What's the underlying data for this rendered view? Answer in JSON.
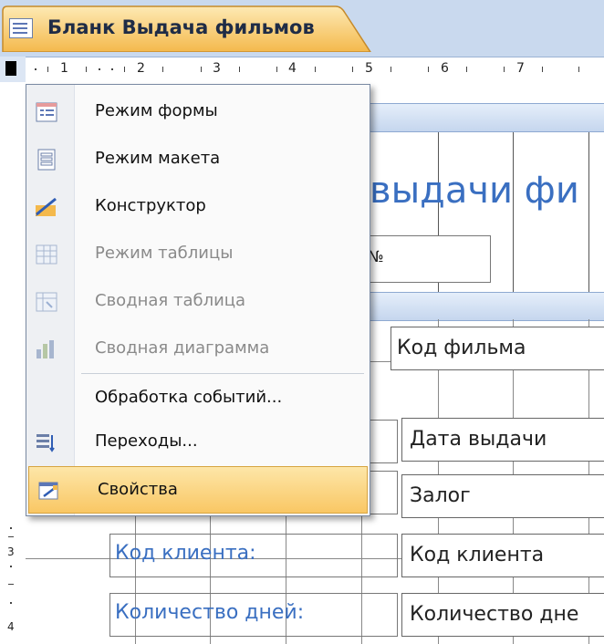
{
  "tab": {
    "title": "Бланк Выдача фильмов"
  },
  "ruler": {
    "h_numbers": [
      "1",
      "2",
      "3",
      "4",
      "5",
      "6",
      "7"
    ],
    "v_numbers": [
      "3",
      "4"
    ]
  },
  "form": {
    "title_fragment": "выдачи фи",
    "number_label": "№",
    "fields": [
      {
        "label": "",
        "value": "Код фильма"
      },
      {
        "label": "",
        "value": "Дата выдачи"
      },
      {
        "label": "",
        "value": "Залог"
      },
      {
        "label": "Код клиента:",
        "value": "Код клиента"
      },
      {
        "label": "Количество дней:",
        "value": "Количество дне"
      }
    ]
  },
  "context_menu": {
    "items": [
      {
        "label": "Режим формы",
        "icon": "form-view-icon",
        "enabled": true
      },
      {
        "label": "Режим макета",
        "icon": "layout-view-icon",
        "enabled": true
      },
      {
        "label": "Конструктор",
        "icon": "design-view-icon",
        "enabled": true
      },
      {
        "label": "Режим таблицы",
        "icon": "datasheet-view-icon",
        "enabled": false
      },
      {
        "label": "Сводная таблица",
        "icon": "pivot-table-icon",
        "enabled": false
      },
      {
        "label": "Сводная диаграмма",
        "icon": "pivot-chart-icon",
        "enabled": false
      },
      {
        "label": "Обработка событий...",
        "icon": "",
        "enabled": true
      },
      {
        "label": "Переходы...",
        "icon": "tab-order-icon",
        "enabled": true
      },
      {
        "label": "Свойства",
        "icon": "properties-icon",
        "enabled": true,
        "selected": true
      }
    ]
  },
  "colors": {
    "accent_label": "#3a6fc1",
    "tab_orange": "#f7c15a",
    "menu_highlight": "#f9c764",
    "ribbon_blue": "#c9d9ee"
  }
}
